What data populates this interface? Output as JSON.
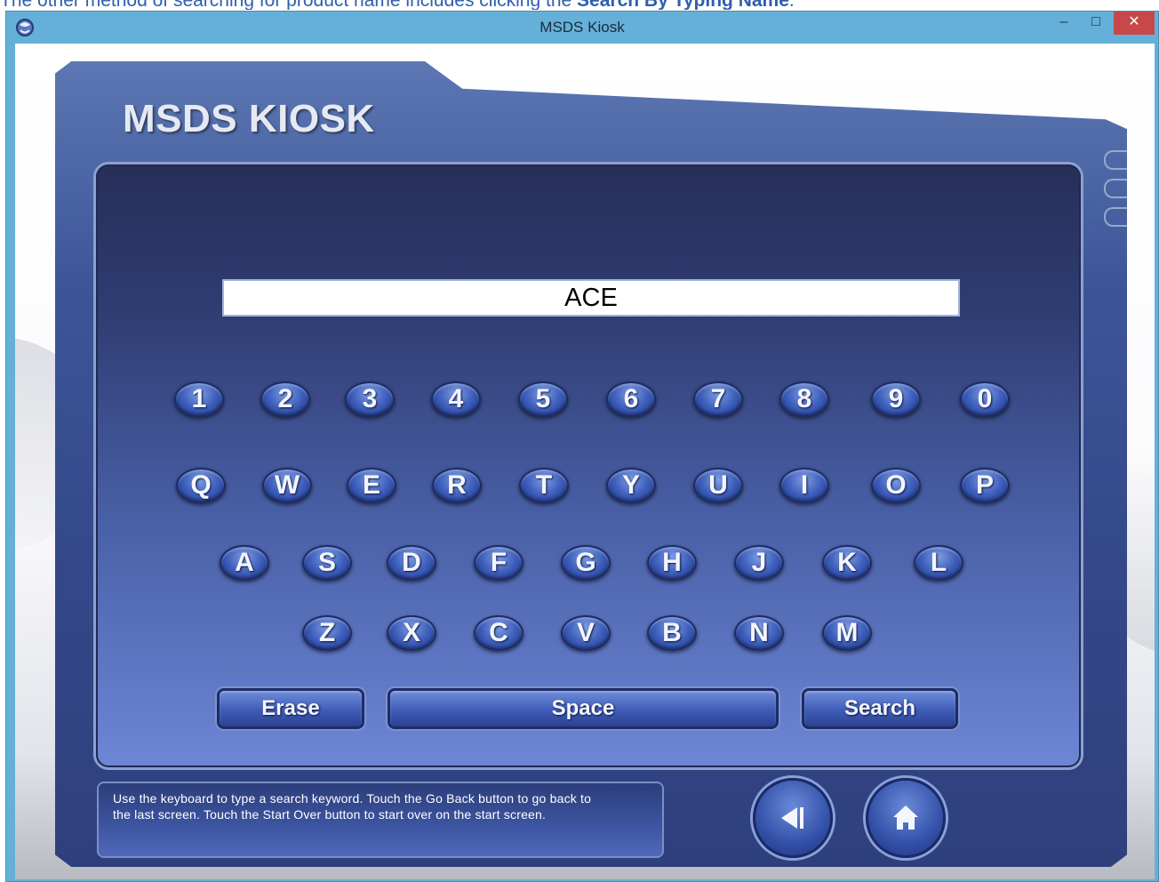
{
  "caption": {
    "prefix": "The other method of searching for product name includes clicking the ",
    "bold": "Search By Typing Name",
    "suffix": "."
  },
  "window": {
    "title": "MSDS Kiosk",
    "minimize_label": "–",
    "maximize_label": "□",
    "close_label": "✕"
  },
  "kiosk": {
    "title": "MSDS KIOSK"
  },
  "search": {
    "value": "ACE"
  },
  "keyboard": {
    "row1": [
      "1",
      "2",
      "3",
      "4",
      "5",
      "6",
      "7",
      "8",
      "9",
      "0"
    ],
    "row2": [
      "Q",
      "W",
      "E",
      "R",
      "T",
      "Y",
      "U",
      "I",
      "O",
      "P"
    ],
    "row3": [
      "A",
      "S",
      "D",
      "F",
      "G",
      "H",
      "J",
      "K",
      "L"
    ],
    "row4": [
      "Z",
      "X",
      "C",
      "V",
      "B",
      "N",
      "M"
    ]
  },
  "buttons": {
    "erase": "Erase",
    "space": "Space",
    "search": "Search"
  },
  "help": {
    "line1": "Use the keyboard to type a search keyword. Touch the Go Back button to go back to",
    "line2": "the last screen. Touch the Start Over button to start over on the start screen."
  },
  "nav": {
    "go_back": "Go Back",
    "start_over": "Start Over"
  },
  "icons": {
    "app": "kiosk-app-icon",
    "go_back": "go-back-icon",
    "start_over": "home-icon"
  }
}
